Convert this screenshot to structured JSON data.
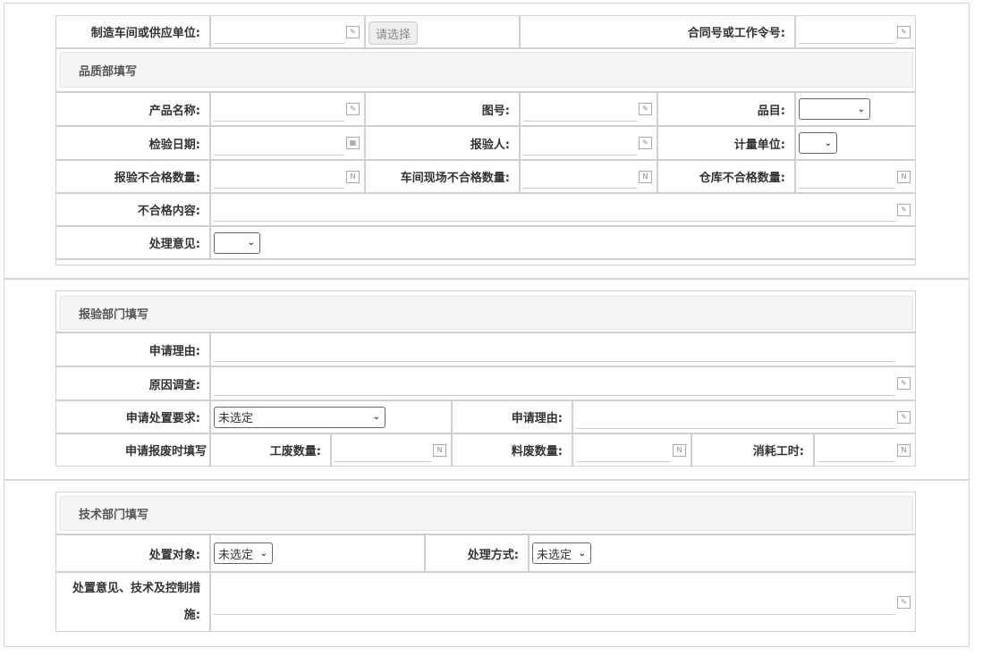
{
  "top": {
    "workshop_label": "制造车间或供应单位:",
    "select_button": "请选择",
    "contract_label": "合同号或工作令号:"
  },
  "quality": {
    "title": "品质部填写",
    "product_name": "产品名称:",
    "drawing_no": "图号:",
    "item": "品目:",
    "inspect_date": "检验日期:",
    "inspector": "报验人:",
    "unit": "计量单位:",
    "reject_qty": "报验不合格数量:",
    "workshop_reject_qty": "车间现场不合格数量:",
    "warehouse_reject_qty": "仓库不合格数量:",
    "reject_content": "不合格内容:",
    "opinion": "处理意见:"
  },
  "inspect": {
    "title": "报验部门填写",
    "apply_reason": "申请理由:",
    "cause": "原因调查:",
    "disposal_req": "申请处置要求:",
    "disposal_value": "未选定",
    "apply_reason2": "申请理由:",
    "scrap_fill": "申请报废时填写",
    "labor_scrap": "工废数量:",
    "material_scrap": "料废数量:",
    "hours": "消耗工时:"
  },
  "tech": {
    "title": "技术部门填写",
    "object": "处置对象:",
    "object_value": "未选定",
    "method": "处理方式:",
    "method_value": "未选定",
    "measures": "处置意见、技术及控制措施:"
  }
}
